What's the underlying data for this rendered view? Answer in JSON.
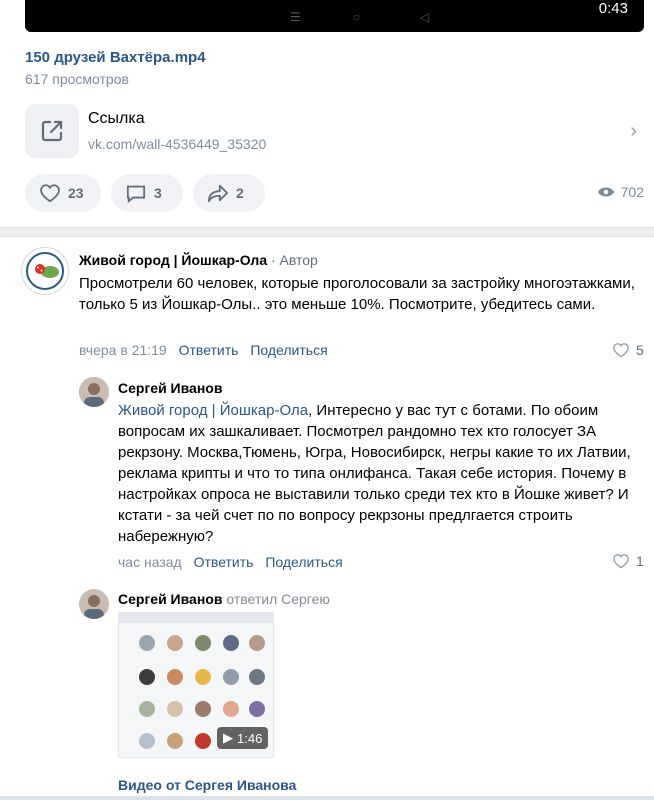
{
  "video": {
    "duration": "0:43",
    "title": "150 друзей Вахтёра.mp4",
    "views": "617 просмотров"
  },
  "link": {
    "name": "Ссылка",
    "url": "vk.com/wall-4536449_35320"
  },
  "actions": {
    "likes": "23",
    "comments": "3",
    "shares": "2",
    "views": "702"
  },
  "comments": [
    {
      "author": "Живой город | Йошкар-Ола",
      "badge": "· Автор",
      "text": "Просмотрели 60 человек, которые проголосовали за застройку многоэтажками, только 5 из Йошкар-Олы.. это меньше 10%. Посмотрите, убедитесь сами.",
      "time": "вчера в 21:19",
      "reply": "Ответить",
      "share": "Поделиться",
      "likes": "5"
    },
    {
      "author": "Сергей Иванов",
      "mention": "Живой город | Йошкар-Ола",
      "text": ", Интересно у вас тут с ботами. По обоим вопросам их зашкаливает. Посмотрел рандомно тех кто голосует ЗА рекрзону. Москва,Тюмень, Югра, Новосибирск, негры какие то их Латвии, реклама крипты и что то типа онлифанса. Такая себе история. Почему в настройках опроса не выставили только среди тех кто в Йошке живет? И кстати - за чей счет по по вопросу рекрзоны предлгается строить набережную?",
      "time": "час назад",
      "reply": "Ответить",
      "share": "Поделиться",
      "likes": "1"
    },
    {
      "author": "Сергей Иванов",
      "replied_to": "ответил Сергею",
      "video_duration": "1:46",
      "video_caption": "Видео от Сергея Иванова"
    }
  ],
  "colors": {
    "link": "#2a5885",
    "muted": "#818c99",
    "pill_bg": "#f0f2f5"
  }
}
